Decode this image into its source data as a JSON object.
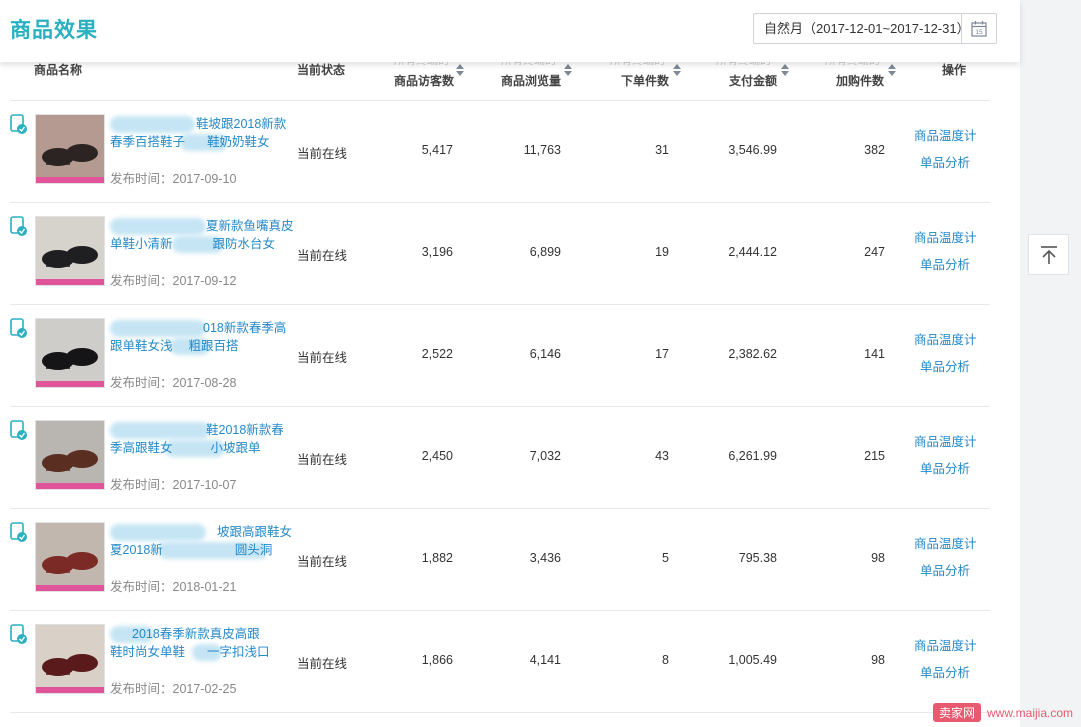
{
  "header": {
    "title": "商品效果",
    "date_range": "自然月（2017-12-01~2017-12-31）",
    "calendar_icon": "calendar-icon",
    "calendar_day": "15"
  },
  "table": {
    "ghost_label": "所有终端的",
    "columns": {
      "name": "商品名称",
      "status": "当前状态",
      "visitors": "商品访客数",
      "views": "商品浏览量",
      "orders": "下单件数",
      "payment": "支付金额",
      "cart": "加购件数",
      "action": "操作"
    },
    "rows": [
      {
        "title_line1": "鞋坡跟2018新款",
        "title_line2_a": "春季百搭鞋子",
        "title_line2_b": "鞋奶奶鞋女",
        "publish_date": "发布时间：2017-09-10",
        "status": "当前在线",
        "visitors": "5,417",
        "views": "11,763",
        "orders": "31",
        "payment": "3,546.99",
        "cart": "382",
        "link1": "商品温度计",
        "link2": "单品分析"
      },
      {
        "title_line1": "夏新款鱼嘴真皮",
        "title_line2_a": "单鞋小清新",
        "title_line2_b": "跟防水台女",
        "publish_date": "发布时间：2017-09-12",
        "status": "当前在线",
        "visitors": "3,196",
        "views": "6,899",
        "orders": "19",
        "payment": "2,444.12",
        "cart": "247",
        "link1": "商品温度计",
        "link2": "单品分析"
      },
      {
        "title_line1": "018新款春季高",
        "title_line2_a": "跟单鞋女浅",
        "title_line2_b": "粗跟百搭",
        "publish_date": "发布时间：2017-08-28",
        "status": "当前在线",
        "visitors": "2,522",
        "views": "6,146",
        "orders": "17",
        "payment": "2,382.62",
        "cart": "141",
        "link1": "商品温度计",
        "link2": "单品分析"
      },
      {
        "title_line1": "鞋2018新款春",
        "title_line2_a": "季高跟鞋女",
        "title_line2_b": "小坡跟单",
        "publish_date": "发布时间：2017-10-07",
        "status": "当前在线",
        "visitors": "2,450",
        "views": "7,032",
        "orders": "43",
        "payment": "6,261.99",
        "cart": "215",
        "link1": "商品温度计",
        "link2": "单品分析"
      },
      {
        "title_line1": "坡跟高跟鞋女",
        "title_line2_a": "夏2018新",
        "title_line2_b": "圆头洞",
        "publish_date": "发布时间：2018-01-21",
        "status": "当前在线",
        "visitors": "1,882",
        "views": "3,436",
        "orders": "5",
        "payment": "795.38",
        "cart": "98",
        "link1": "商品温度计",
        "link2": "单品分析"
      },
      {
        "title_line1": "2018春季新款真皮高跟",
        "title_line2_a": "鞋时尚女单鞋",
        "title_line2_b": "一字扣浅口",
        "publish_date": "发布时间：2017-02-25",
        "status": "当前在线",
        "visitors": "1,866",
        "views": "4,141",
        "orders": "8",
        "payment": "1,005.49",
        "cart": "98",
        "link1": "商品温度计",
        "link2": "单品分析"
      }
    ]
  },
  "back_to_top_icon": "arrow-up-to-line-icon",
  "watermark": {
    "brand": "卖家网",
    "url": "www.maijia.com"
  },
  "colors": {
    "accent": "#2ab0c0",
    "link": "#2489c8",
    "brand_pink": "#e85a6f"
  }
}
